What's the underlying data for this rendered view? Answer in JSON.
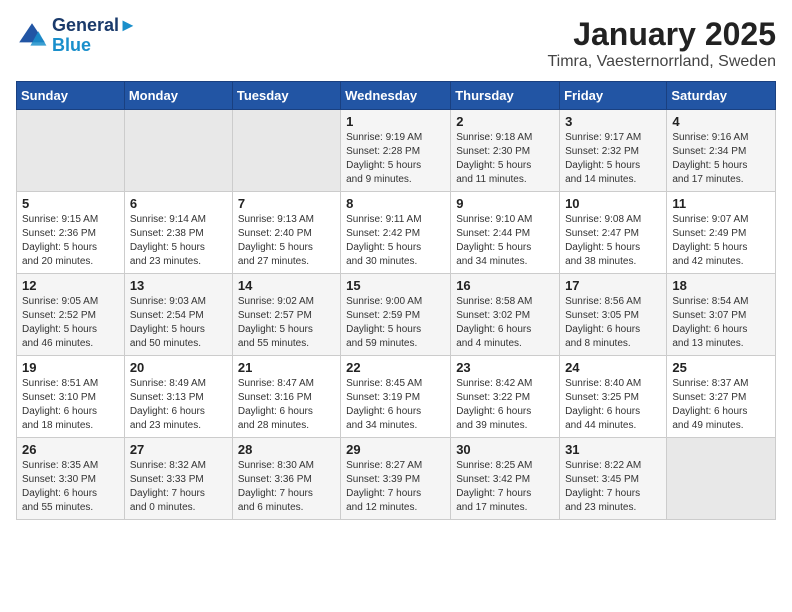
{
  "header": {
    "logo_line1": "General",
    "logo_line2": "Blue",
    "title": "January 2025",
    "subtitle": "Timra, Vaesternorrland, Sweden"
  },
  "weekdays": [
    "Sunday",
    "Monday",
    "Tuesday",
    "Wednesday",
    "Thursday",
    "Friday",
    "Saturday"
  ],
  "weeks": [
    [
      {
        "day": "",
        "info": ""
      },
      {
        "day": "",
        "info": ""
      },
      {
        "day": "",
        "info": ""
      },
      {
        "day": "1",
        "info": "Sunrise: 9:19 AM\nSunset: 2:28 PM\nDaylight: 5 hours\nand 9 minutes."
      },
      {
        "day": "2",
        "info": "Sunrise: 9:18 AM\nSunset: 2:30 PM\nDaylight: 5 hours\nand 11 minutes."
      },
      {
        "day": "3",
        "info": "Sunrise: 9:17 AM\nSunset: 2:32 PM\nDaylight: 5 hours\nand 14 minutes."
      },
      {
        "day": "4",
        "info": "Sunrise: 9:16 AM\nSunset: 2:34 PM\nDaylight: 5 hours\nand 17 minutes."
      }
    ],
    [
      {
        "day": "5",
        "info": "Sunrise: 9:15 AM\nSunset: 2:36 PM\nDaylight: 5 hours\nand 20 minutes."
      },
      {
        "day": "6",
        "info": "Sunrise: 9:14 AM\nSunset: 2:38 PM\nDaylight: 5 hours\nand 23 minutes."
      },
      {
        "day": "7",
        "info": "Sunrise: 9:13 AM\nSunset: 2:40 PM\nDaylight: 5 hours\nand 27 minutes."
      },
      {
        "day": "8",
        "info": "Sunrise: 9:11 AM\nSunset: 2:42 PM\nDaylight: 5 hours\nand 30 minutes."
      },
      {
        "day": "9",
        "info": "Sunrise: 9:10 AM\nSunset: 2:44 PM\nDaylight: 5 hours\nand 34 minutes."
      },
      {
        "day": "10",
        "info": "Sunrise: 9:08 AM\nSunset: 2:47 PM\nDaylight: 5 hours\nand 38 minutes."
      },
      {
        "day": "11",
        "info": "Sunrise: 9:07 AM\nSunset: 2:49 PM\nDaylight: 5 hours\nand 42 minutes."
      }
    ],
    [
      {
        "day": "12",
        "info": "Sunrise: 9:05 AM\nSunset: 2:52 PM\nDaylight: 5 hours\nand 46 minutes."
      },
      {
        "day": "13",
        "info": "Sunrise: 9:03 AM\nSunset: 2:54 PM\nDaylight: 5 hours\nand 50 minutes."
      },
      {
        "day": "14",
        "info": "Sunrise: 9:02 AM\nSunset: 2:57 PM\nDaylight: 5 hours\nand 55 minutes."
      },
      {
        "day": "15",
        "info": "Sunrise: 9:00 AM\nSunset: 2:59 PM\nDaylight: 5 hours\nand 59 minutes."
      },
      {
        "day": "16",
        "info": "Sunrise: 8:58 AM\nSunset: 3:02 PM\nDaylight: 6 hours\nand 4 minutes."
      },
      {
        "day": "17",
        "info": "Sunrise: 8:56 AM\nSunset: 3:05 PM\nDaylight: 6 hours\nand 8 minutes."
      },
      {
        "day": "18",
        "info": "Sunrise: 8:54 AM\nSunset: 3:07 PM\nDaylight: 6 hours\nand 13 minutes."
      }
    ],
    [
      {
        "day": "19",
        "info": "Sunrise: 8:51 AM\nSunset: 3:10 PM\nDaylight: 6 hours\nand 18 minutes."
      },
      {
        "day": "20",
        "info": "Sunrise: 8:49 AM\nSunset: 3:13 PM\nDaylight: 6 hours\nand 23 minutes."
      },
      {
        "day": "21",
        "info": "Sunrise: 8:47 AM\nSunset: 3:16 PM\nDaylight: 6 hours\nand 28 minutes."
      },
      {
        "day": "22",
        "info": "Sunrise: 8:45 AM\nSunset: 3:19 PM\nDaylight: 6 hours\nand 34 minutes."
      },
      {
        "day": "23",
        "info": "Sunrise: 8:42 AM\nSunset: 3:22 PM\nDaylight: 6 hours\nand 39 minutes."
      },
      {
        "day": "24",
        "info": "Sunrise: 8:40 AM\nSunset: 3:25 PM\nDaylight: 6 hours\nand 44 minutes."
      },
      {
        "day": "25",
        "info": "Sunrise: 8:37 AM\nSunset: 3:27 PM\nDaylight: 6 hours\nand 49 minutes."
      }
    ],
    [
      {
        "day": "26",
        "info": "Sunrise: 8:35 AM\nSunset: 3:30 PM\nDaylight: 6 hours\nand 55 minutes."
      },
      {
        "day": "27",
        "info": "Sunrise: 8:32 AM\nSunset: 3:33 PM\nDaylight: 7 hours\nand 0 minutes."
      },
      {
        "day": "28",
        "info": "Sunrise: 8:30 AM\nSunset: 3:36 PM\nDaylight: 7 hours\nand 6 minutes."
      },
      {
        "day": "29",
        "info": "Sunrise: 8:27 AM\nSunset: 3:39 PM\nDaylight: 7 hours\nand 12 minutes."
      },
      {
        "day": "30",
        "info": "Sunrise: 8:25 AM\nSunset: 3:42 PM\nDaylight: 7 hours\nand 17 minutes."
      },
      {
        "day": "31",
        "info": "Sunrise: 8:22 AM\nSunset: 3:45 PM\nDaylight: 7 hours\nand 23 minutes."
      },
      {
        "day": "",
        "info": ""
      }
    ]
  ]
}
